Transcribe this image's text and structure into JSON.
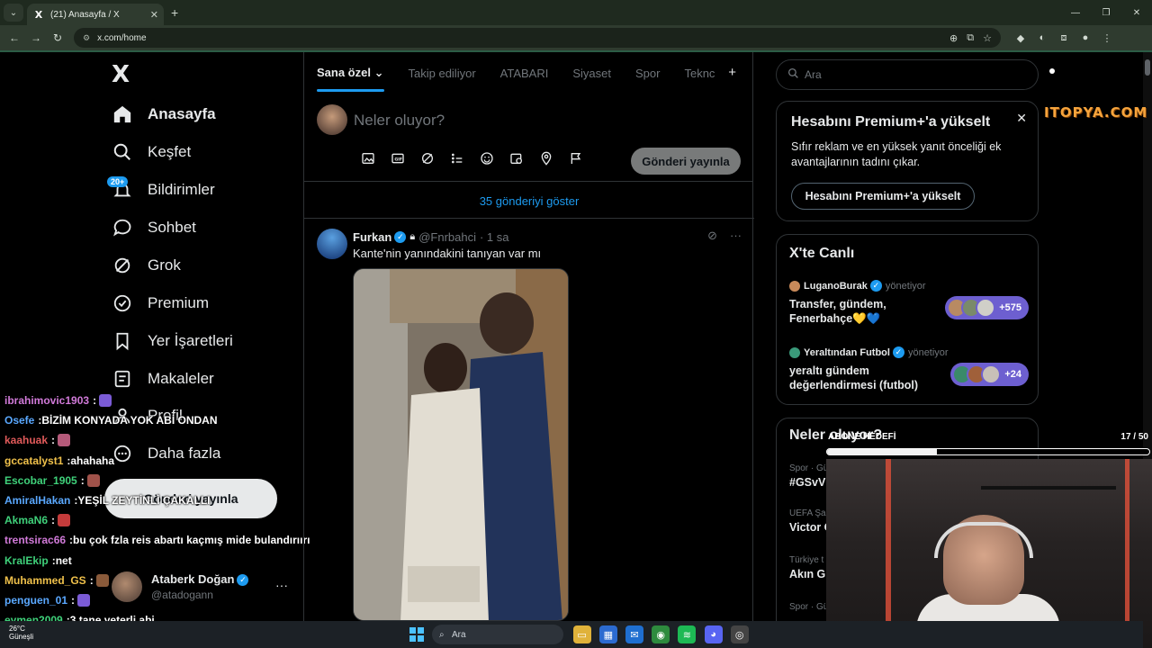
{
  "browser": {
    "tab_title": "(21) Anasayfa / X",
    "url": "x.com/home",
    "new_tab_symbol": "+"
  },
  "sidebar": {
    "logo": "X",
    "items": [
      {
        "label": "Anasayfa",
        "icon": "home-icon"
      },
      {
        "label": "Keşfet",
        "icon": "search-icon"
      },
      {
        "label": "Bildirimler",
        "icon": "bell-icon"
      },
      {
        "label": "Sohbet",
        "icon": "chat-icon"
      },
      {
        "label": "Grok",
        "icon": "grok-icon"
      },
      {
        "label": "Premium",
        "icon": "premium-icon"
      },
      {
        "label": "Yer İşaretleri",
        "icon": "bookmark-icon"
      },
      {
        "label": "Makaleler",
        "icon": "article-icon"
      },
      {
        "label": "Profil",
        "icon": "profile-icon"
      },
      {
        "label": "Daha fazla",
        "icon": "more-circle-icon"
      }
    ],
    "notif_badge": "20+",
    "post_button": "Gönderi yayınla",
    "account": {
      "name": "Ataberk Doğan",
      "handle": "@atadogann"
    }
  },
  "chat": [
    {
      "user": "ibrahimovic1903",
      "color": "#d17ad9",
      "text": "",
      "emote": "#7b5bd6"
    },
    {
      "user": "Osefe",
      "color": "#5aa8ff",
      "text": "BİZİM KONYADA YOK ABİ ONDAN",
      "emote": ""
    },
    {
      "user": "kaahuak",
      "color": "#e05a5a",
      "text": "",
      "emote": "#b55a7a"
    },
    {
      "user": "gccatalyst1",
      "color": "#f0c14b",
      "text": "ahahaha",
      "emote": ""
    },
    {
      "user": "Escobar_1905",
      "color": "#3fd17a",
      "text": "",
      "emote": "#a0524a"
    },
    {
      "user": "AmiralHakan",
      "color": "#5aa8ff",
      "text": "YEŞİL ZEYTİNLİ ÇAKALLI",
      "emote": ""
    },
    {
      "user": "AkmaN6",
      "color": "#3fd17a",
      "text": "",
      "emote": "#c43b3b"
    },
    {
      "user": "trentsirac66",
      "color": "#d17ad9",
      "text": "bu çok fzla reis abartı kaçmış mide bulandırıırı",
      "emote": ""
    },
    {
      "user": "KralEkip",
      "color": "#3fd17a",
      "text": "net",
      "emote": ""
    },
    {
      "user": "Muhammed_GS",
      "color": "#f0c14b",
      "text": "",
      "emote": "#8a5a3a"
    },
    {
      "user": "penguen_01",
      "color": "#5aa8ff",
      "text": "",
      "emote": "#7b5bd6"
    },
    {
      "user": "eymen2009",
      "color": "#3fd17a",
      "text": "3 tane yeterli abi",
      "emote": ""
    }
  ],
  "feed": {
    "tabs": [
      "Sana özel",
      "Takip ediliyor",
      "ATABARI",
      "Siyaset",
      "Spor",
      "Teknc"
    ],
    "tab_add": "+",
    "compose_placeholder": "Neler oluyor?",
    "compose_tools": [
      "image-icon",
      "gif-icon",
      "grok-icon",
      "poll-icon",
      "emoji-icon",
      "schedule-icon",
      "location-icon",
      "flag-icon"
    ],
    "compose_post_button": "Gönderi yayınla",
    "show_more": "35 gönderiyi göster",
    "tweet": {
      "name": "Furkan",
      "handle": "@Fnrbahci",
      "time": "· 1 sa",
      "text": "Kante'nin yanındakini tanıyan var mı"
    }
  },
  "right": {
    "search_placeholder": "Ara",
    "premium": {
      "title": "Hesabını Premium+'a yükselt",
      "body": "Sıfır reklam ve en yüksek yanıt önceliği ek avantajlarının tadını çıkar.",
      "button": "Hesabını Premium+'a yükselt"
    },
    "live": {
      "title": "X'te Canlı",
      "items": [
        {
          "host": "LuganoBurak",
          "status": "yönetiyor",
          "topic": "Transfer, gündem, Fenerbahçe💛💙",
          "count": "+575"
        },
        {
          "host": "Yeraltından Futbol",
          "status": "yönetiyor",
          "topic": "yeraltı gündem değerlendirmesi (futbol)",
          "count": "+24"
        }
      ]
    },
    "trends": {
      "title": "Neler oluyor?",
      "items": [
        {
          "cat": "Spor · Gü",
          "name": "#GSvV"
        },
        {
          "cat": "UEFA Şa",
          "name": "Victor O"
        },
        {
          "cat": "Türkiye t",
          "name": "Akın Gü"
        },
        {
          "cat": "Spor · Gü",
          "name": ""
        }
      ]
    }
  },
  "overlay": {
    "watermark": "ITOPYA.COM",
    "sub_goal_label": "ABONE HEDEFİ",
    "sub_goal_count": "17 / 50",
    "sub_goal_progress": 0.34
  },
  "taskbar": {
    "weather_temp": "26°C",
    "weather_desc": "Güneşli",
    "search": "Ara"
  }
}
